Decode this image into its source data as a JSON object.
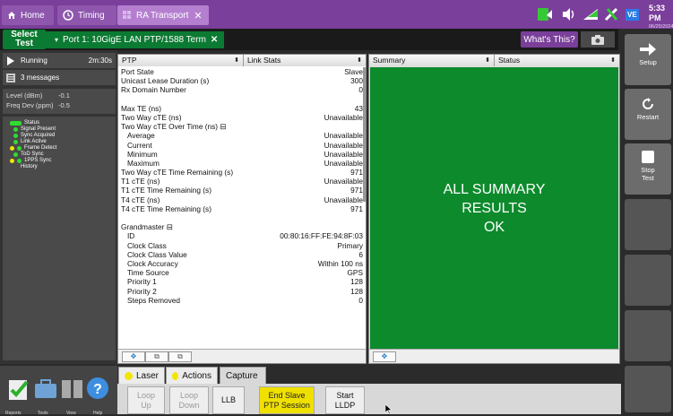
{
  "topbar": {
    "tabs": [
      {
        "label": "Home"
      },
      {
        "label": "Timing"
      },
      {
        "label": "RA Transport"
      }
    ],
    "clock_time": "5:33 PM",
    "clock_date": "06/25/2024",
    "vnc_badge": "VE"
  },
  "secbar": {
    "select_test": "Select Test",
    "port_tab": "Port 1: 10GigE LAN PTP/1588 Term",
    "whats_this": "What's This?"
  },
  "leftpanel": {
    "running_label": "Running",
    "running_time": "2m:30s",
    "messages_label": "3 messages",
    "level_label": "Level (dBm)",
    "level_value": "-0.1",
    "freq_label": "Freq Dev (ppm)",
    "freq_value": "-0.5",
    "status_items": [
      {
        "label": "Status",
        "led": "green-bar"
      },
      {
        "label": "Signal Present",
        "led": "green"
      },
      {
        "label": "Sync Acquired",
        "led": "green"
      },
      {
        "label": "Link Active",
        "led": "green"
      },
      {
        "label": "Frame Detect",
        "led": "yellow"
      },
      {
        "label": "ToD Sync",
        "led": "green"
      },
      {
        "label": "1PPS Sync",
        "led": "green"
      },
      {
        "label": "History",
        "led": "none"
      }
    ]
  },
  "left_pane": {
    "header_a": "PTP",
    "header_b": "Link Stats",
    "rows": [
      {
        "label": "Port State",
        "value": "Slave",
        "indent": false
      },
      {
        "label": "Unicast Lease Duration (s)",
        "value": "300",
        "indent": false
      },
      {
        "label": "Rx Domain Number",
        "value": "0",
        "indent": false
      },
      {
        "label": "",
        "value": "",
        "indent": false
      },
      {
        "label": "Max TE (ns)",
        "value": "43",
        "indent": false
      },
      {
        "label": "Two Way cTE (ns)",
        "value": "Unavailable",
        "indent": false
      },
      {
        "label": "Two Way cTE Over Time (ns) ⊟",
        "value": "",
        "indent": false
      },
      {
        "label": "Average",
        "value": "Unavailable",
        "indent": true
      },
      {
        "label": "Current",
        "value": "Unavailable",
        "indent": true
      },
      {
        "label": "Minimum",
        "value": "Unavailable",
        "indent": true
      },
      {
        "label": "Maximum",
        "value": "Unavailable",
        "indent": true
      },
      {
        "label": "Two Way cTE Time Remaining (s)",
        "value": "971",
        "indent": false
      },
      {
        "label": "T1 cTE (ns)",
        "value": "Unavailable",
        "indent": false
      },
      {
        "label": "T1 cTE Time Remaining (s)",
        "value": "971",
        "indent": false
      },
      {
        "label": "T4 cTE (ns)",
        "value": "Unavailable",
        "indent": false
      },
      {
        "label": "T4 cTE Time Remaining (s)",
        "value": "971",
        "indent": false
      },
      {
        "label": "",
        "value": "",
        "indent": false
      },
      {
        "label": "Grandmaster ⊟",
        "value": "",
        "indent": false
      },
      {
        "label": "ID",
        "value": "00:80:16:FF:FE:94:8F:03",
        "indent": true
      },
      {
        "label": "Clock Class",
        "value": "Primary",
        "indent": true
      },
      {
        "label": "Clock Class Value",
        "value": "6",
        "indent": true
      },
      {
        "label": "Clock Accuracy",
        "value": "Within 100 ns",
        "indent": true
      },
      {
        "label": "Time Source",
        "value": "GPS",
        "indent": true
      },
      {
        "label": "Priority 1",
        "value": "128",
        "indent": true
      },
      {
        "label": "Priority 2",
        "value": "128",
        "indent": true
      },
      {
        "label": "Steps Removed",
        "value": "0",
        "indent": true
      }
    ]
  },
  "right_pane": {
    "header_a": "Summary",
    "header_b": "Status",
    "summary_lines": [
      "ALL SUMMARY",
      "RESULTS",
      "OK"
    ]
  },
  "rightbar": {
    "setup": "Setup",
    "restart": "Restart",
    "stop_test": "Stop Test"
  },
  "bottom_tabs": {
    "laser": "Laser",
    "actions": "Actions",
    "capture": "Capture"
  },
  "actions": {
    "loop_up": "Loop Up",
    "loop_down": "Loop Down",
    "llb": "LLB",
    "end_slave": "End Slave PTP Session",
    "start_lldp": "Start LLDP"
  },
  "bottomicons": {
    "reports": "Reports",
    "tools": "Tools",
    "view": "View",
    "help": "Help"
  },
  "colors": {
    "accent_purple": "#7a3f9a",
    "test_green": "#0b7a32",
    "summary_green": "#0d8a2c",
    "highlight_yellow": "#f0e000"
  }
}
